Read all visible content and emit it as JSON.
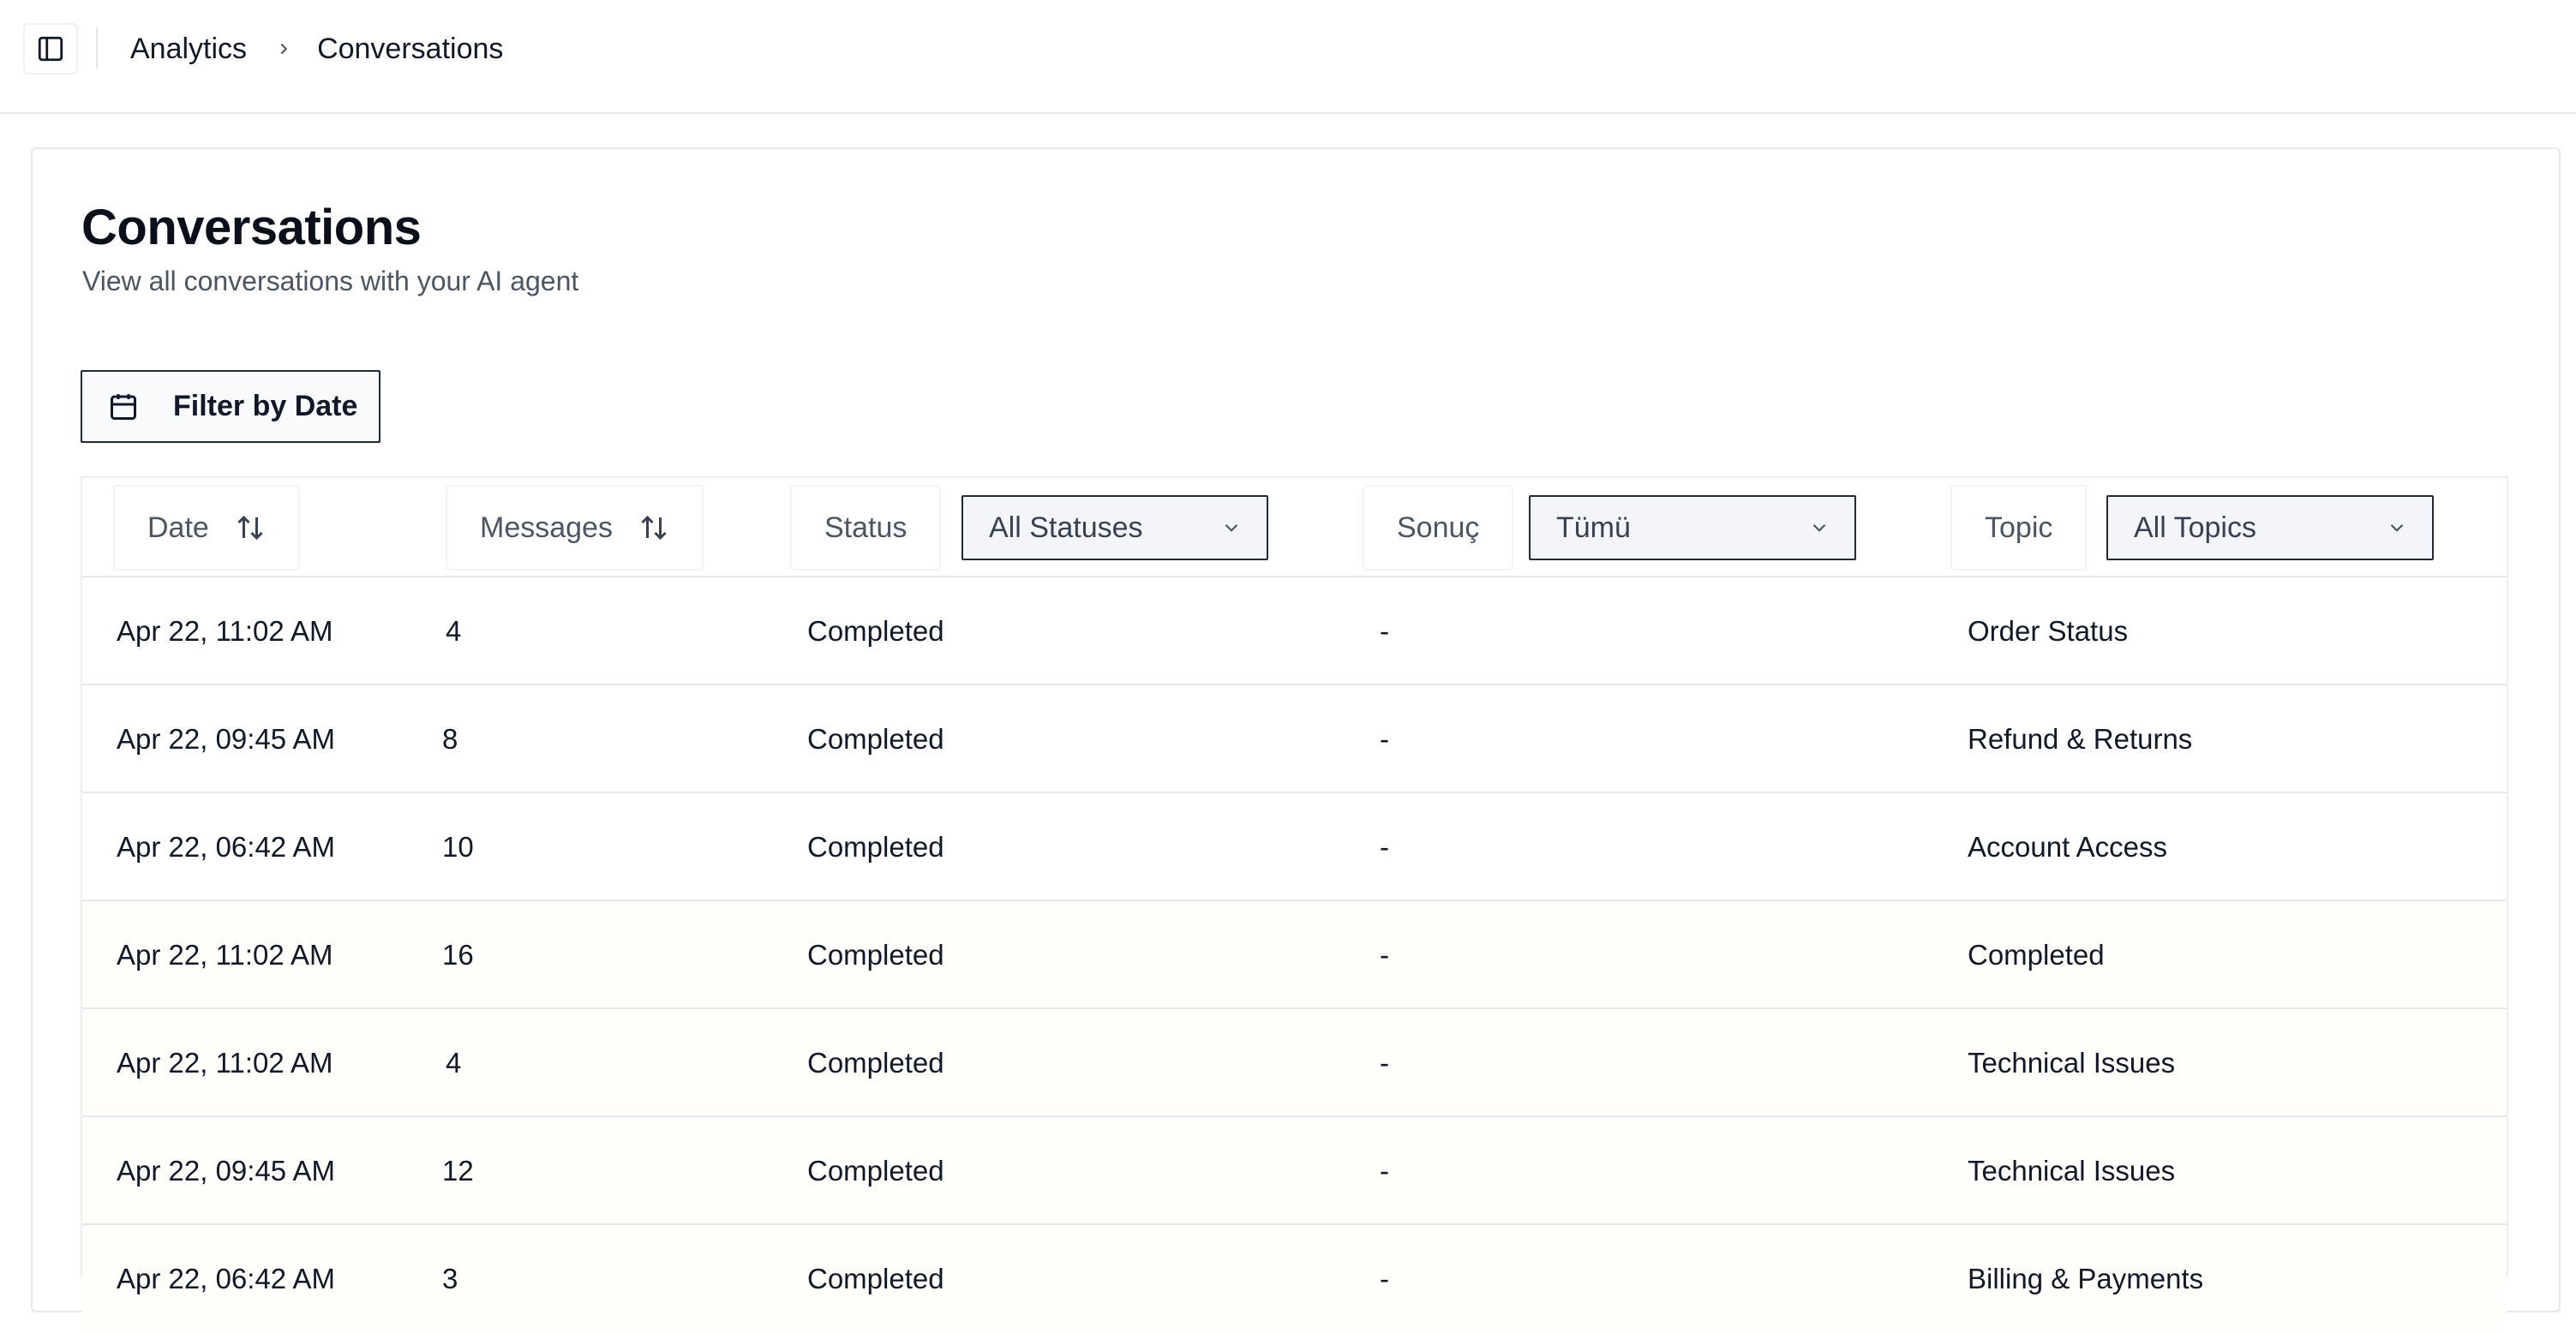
{
  "breadcrumb": {
    "parent": "Analytics",
    "current": "Conversations"
  },
  "page": {
    "title": "Conversations",
    "subtitle": "View all conversations with your AI agent"
  },
  "filter_button": {
    "label": "Filter by Date",
    "icon": "calendar-icon"
  },
  "columns": {
    "date": "Date",
    "messages": "Messages",
    "status": "Status",
    "result": "Sonuç",
    "topic": "Topic"
  },
  "selects": {
    "status": "All Statuses",
    "result": "Tümü",
    "topic": "All Topics"
  },
  "rows": [
    {
      "date": "Apr 22, 11:02 AM",
      "messages": "4",
      "status": "Completed",
      "result": "-",
      "topic": "Order Status"
    },
    {
      "date": "Apr 22, 09:45 AM",
      "messages": "8",
      "status": "Completed",
      "result": "-",
      "topic": "Refund & Returns"
    },
    {
      "date": "Apr 22, 06:42 AM",
      "messages": "10",
      "status": "Completed",
      "result": "-",
      "topic": "Account Access"
    },
    {
      "date": "Apr 22, 11:02 AM",
      "messages": "16",
      "status": "Completed",
      "result": "-",
      "topic": "Completed"
    },
    {
      "date": "Apr 22, 11:02 AM",
      "messages": "4",
      "status": "Completed",
      "result": "-",
      "topic": "Technical Issues"
    },
    {
      "date": "Apr 22, 09:45 AM",
      "messages": "12",
      "status": "Completed",
      "result": "-",
      "topic": "Technical Issues"
    },
    {
      "date": "Apr 22, 06:42 AM",
      "messages": "3",
      "status": "Completed",
      "result": "-",
      "topic": "Billing & Payments"
    }
  ]
}
